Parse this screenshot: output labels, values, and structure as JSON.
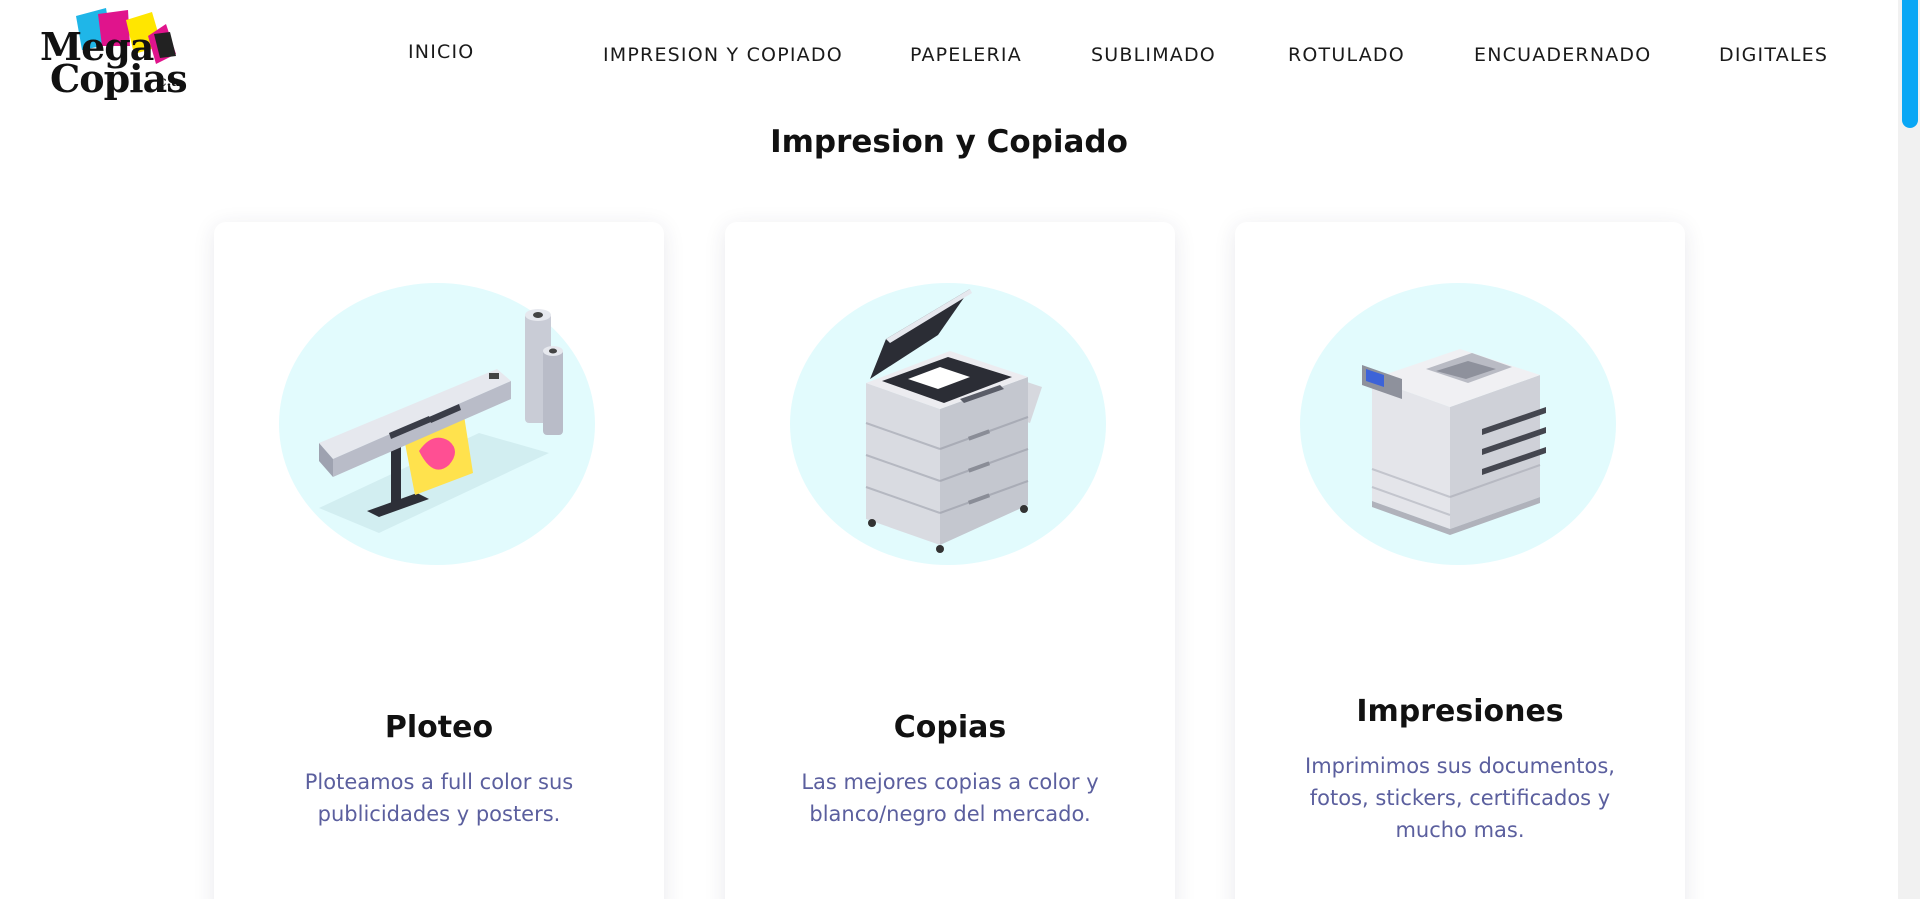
{
  "brand": {
    "logo_line1": "Mega",
    "logo_line2": "Copias",
    "logo_suffix": "c.a"
  },
  "nav": {
    "items": [
      {
        "label": "INICIO"
      },
      {
        "label": "IMPRESION Y COPIADO"
      },
      {
        "label": "PAPELERIA"
      },
      {
        "label": "SUBLIMADO"
      },
      {
        "label": "ROTULADO"
      },
      {
        "label": "ENCUADERNADO"
      },
      {
        "label": "DIGITALES"
      }
    ]
  },
  "section": {
    "title": "Impresion y Copiado"
  },
  "cards": [
    {
      "icon": "plotter-icon",
      "title": "Ploteo",
      "text": "Ploteamos a full color sus publicidades y posters."
    },
    {
      "icon": "photocopier-icon",
      "title": "Copias",
      "text": "Las mejores copias a color y blanco/negro del mercado."
    },
    {
      "icon": "printer-icon",
      "title": "Impresiones",
      "text": "Imprimimos sus documentos, fotos, stickers, certificados y mucho mas."
    }
  ],
  "colors": {
    "accent": "#0aa7f5",
    "card_circle": "#e2fbfd",
    "description_text": "#5b5f9e",
    "logo_cyan": "#1fb6e8",
    "logo_magenta": "#e0148c",
    "logo_yellow": "#ffe600"
  }
}
